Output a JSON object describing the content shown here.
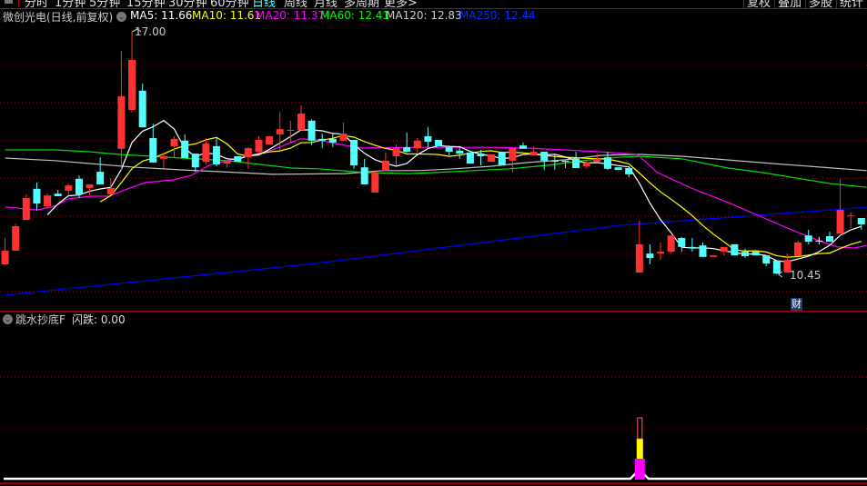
{
  "menu": {
    "items": [
      "分时",
      "1分钟",
      "5分钟",
      "15分钟",
      "30分钟",
      "60分钟",
      "日线",
      "周线",
      "月线",
      "多周期",
      "更多>"
    ],
    "active_index": 6,
    "right_buttons": [
      "复权",
      "叠加",
      "多股",
      "统计"
    ]
  },
  "header": {
    "title": "微创光电(日线,前复权)",
    "ma5": "MA5: 11.66",
    "ma10": "MA10: 11.61",
    "ma20": "MA20: 11.37",
    "ma60": "MA60: 12.41",
    "ma120": "MA120: 12.83",
    "ma250": "MA250: 12.44"
  },
  "annotations": {
    "high_label": "17.00",
    "low_label": "10.45",
    "finance_badge": "财"
  },
  "indicator": {
    "title": "跳水抄底F",
    "value_label": "闪跌: 0.00",
    "signal_index": 60
  },
  "colors": {
    "up": "#ff3232",
    "down": "#54ffff",
    "ma5": "#ffffff",
    "ma10": "#ffff00",
    "ma20": "#ff00ff",
    "ma60": "#00e000",
    "ma120": "#c0c0c0",
    "ma250": "#0000ff",
    "grid": "#a00000"
  },
  "chart_data": {
    "type": "candlestick",
    "price_range": [
      10.45,
      17.0
    ],
    "ohlc": [
      [
        10.72,
        11.43,
        10.72,
        11.09
      ],
      [
        11.09,
        11.82,
        11.09,
        11.75
      ],
      [
        11.92,
        12.61,
        11.92,
        12.51
      ],
      [
        12.76,
        12.93,
        12.17,
        12.36
      ],
      [
        12.29,
        12.63,
        12.24,
        12.58
      ],
      [
        12.63,
        12.73,
        12.56,
        12.56
      ],
      [
        12.71,
        12.9,
        12.58,
        12.85
      ],
      [
        13.03,
        13.12,
        12.51,
        12.61
      ],
      [
        12.78,
        12.88,
        12.58,
        12.88
      ],
      [
        13.22,
        13.61,
        12.88,
        12.88
      ],
      [
        12.61,
        13.05,
        12.61,
        12.78
      ],
      [
        13.84,
        16.48,
        13.27,
        15.26
      ],
      [
        14.89,
        17.0,
        14.82,
        16.24
      ],
      [
        15.41,
        15.6,
        14.42,
        14.42
      ],
      [
        14.13,
        14.52,
        13.47,
        13.47
      ],
      [
        13.57,
        13.74,
        13.32,
        13.64
      ],
      [
        13.91,
        14.18,
        13.61,
        14.11
      ],
      [
        14.06,
        14.23,
        13.59,
        13.59
      ],
      [
        13.71,
        13.71,
        13.22,
        13.34
      ],
      [
        13.49,
        14.13,
        13.42,
        13.98
      ],
      [
        13.91,
        14.13,
        13.37,
        13.42
      ],
      [
        13.44,
        13.52,
        13.32,
        13.52
      ],
      [
        13.64,
        13.64,
        13.49,
        13.49
      ],
      [
        13.61,
        13.88,
        13.3,
        13.86
      ],
      [
        13.76,
        14.18,
        13.76,
        14.08
      ],
      [
        13.96,
        14.18,
        13.96,
        14.18
      ],
      [
        14.23,
        14.84,
        13.81,
        14.37
      ],
      [
        14.33,
        14.6,
        14.01,
        14.35
      ],
      [
        14.35,
        15.01,
        14.35,
        14.79
      ],
      [
        14.6,
        14.64,
        13.93,
        14.06
      ],
      [
        14.11,
        14.25,
        13.86,
        14.06
      ],
      [
        14.11,
        14.25,
        13.88,
        14.01
      ],
      [
        14.06,
        14.55,
        14.06,
        14.25
      ],
      [
        14.08,
        14.08,
        13.3,
        13.39
      ],
      [
        13.34,
        13.57,
        12.88,
        12.88
      ],
      [
        12.66,
        13.22,
        12.66,
        13.2
      ],
      [
        13.25,
        13.74,
        13.25,
        13.52
      ],
      [
        13.64,
        13.96,
        13.39,
        13.86
      ],
      [
        13.88,
        14.28,
        13.74,
        13.76
      ],
      [
        13.86,
        14.13,
        13.74,
        14.06
      ],
      [
        14.18,
        14.42,
        13.88,
        14.03
      ],
      [
        14.08,
        14.08,
        13.91,
        13.91
      ],
      [
        13.88,
        13.93,
        13.66,
        13.76
      ],
      [
        13.79,
        13.86,
        13.57,
        13.71
      ],
      [
        13.74,
        13.74,
        13.44,
        13.44
      ],
      [
        13.71,
        13.81,
        13.39,
        13.64
      ],
      [
        13.49,
        13.69,
        13.49,
        13.69
      ],
      [
        13.76,
        13.76,
        13.39,
        13.39
      ],
      [
        13.52,
        13.88,
        13.2,
        13.86
      ],
      [
        13.93,
        14.01,
        13.84,
        13.84
      ],
      [
        13.66,
        13.91,
        13.66,
        13.76
      ],
      [
        13.76,
        13.76,
        13.27,
        13.52
      ],
      [
        13.52,
        13.71,
        13.27,
        13.49
      ],
      [
        13.52,
        13.52,
        13.32,
        13.49
      ],
      [
        13.57,
        13.76,
        13.32,
        13.32
      ],
      [
        13.37,
        13.54,
        13.3,
        13.47
      ],
      [
        13.49,
        13.71,
        13.49,
        13.57
      ],
      [
        13.61,
        13.76,
        13.27,
        13.3
      ],
      [
        13.34,
        13.34,
        13.27,
        13.27
      ],
      [
        13.32,
        13.32,
        13.07,
        13.15
      ],
      [
        10.5,
        11.9,
        10.5,
        11.26
      ],
      [
        11.01,
        11.26,
        10.72,
        10.89
      ],
      [
        11.01,
        11.31,
        10.84,
        11.06
      ],
      [
        11.06,
        11.5,
        11.01,
        11.5
      ],
      [
        11.43,
        11.46,
        11.06,
        11.19
      ],
      [
        11.19,
        11.43,
        11.06,
        11.16
      ],
      [
        11.23,
        11.31,
        10.92,
        10.92
      ],
      [
        10.92,
        10.96,
        10.92,
        10.96
      ],
      [
        11.06,
        11.19,
        10.96,
        11.19
      ],
      [
        11.26,
        11.26,
        10.96,
        10.96
      ],
      [
        11.06,
        11.14,
        10.89,
        10.94
      ],
      [
        11.06,
        11.06,
        10.96,
        10.96
      ],
      [
        10.96,
        10.96,
        10.67,
        10.74
      ],
      [
        10.82,
        10.82,
        10.45,
        10.47
      ],
      [
        10.5,
        11.01,
        10.5,
        10.84
      ],
      [
        10.94,
        11.36,
        10.94,
        11.31
      ],
      [
        11.5,
        11.65,
        11.26,
        11.33
      ],
      [
        11.36,
        11.46,
        11.26,
        11.36
      ],
      [
        11.48,
        11.6,
        11.33,
        11.33
      ],
      [
        11.55,
        13.03,
        11.55,
        12.19
      ],
      [
        12.02,
        12.12,
        11.7,
        12.04
      ],
      [
        11.97,
        11.97,
        11.65,
        11.8
      ]
    ],
    "ma_keypoints": {
      "ma20": [
        [
          0,
          12.27
        ],
        [
          3,
          12.19
        ],
        [
          4.7,
          12.29
        ],
        [
          6,
          12.49
        ],
        [
          8.1,
          12.56
        ],
        [
          9.8,
          12.56
        ],
        [
          11.6,
          12.76
        ],
        [
          13.3,
          12.93
        ],
        [
          15.9,
          13.0
        ],
        [
          17.6,
          13.12
        ],
        [
          19.3,
          13.39
        ],
        [
          21,
          13.52
        ],
        [
          23.6,
          13.69
        ],
        [
          25.3,
          13.81
        ],
        [
          27.9,
          14.11
        ],
        [
          29.6,
          14.08
        ],
        [
          32.2,
          13.93
        ],
        [
          33.9,
          13.86
        ],
        [
          39.1,
          13.88
        ],
        [
          46,
          13.88
        ],
        [
          49.4,
          13.86
        ],
        [
          52.9,
          13.81
        ],
        [
          56.3,
          13.76
        ],
        [
          59.8,
          13.69
        ],
        [
          61.7,
          13.2
        ],
        [
          64.9,
          12.78
        ],
        [
          68.4,
          12.39
        ],
        [
          71.8,
          11.97
        ],
        [
          74.4,
          11.65
        ],
        [
          77,
          11.36
        ],
        [
          78.7,
          11.19
        ],
        [
          80.4,
          11.16
        ],
        [
          81.5,
          11.23
        ]
      ],
      "ma60": [
        [
          0,
          13.81
        ],
        [
          4.7,
          13.81
        ],
        [
          8.1,
          13.76
        ],
        [
          10.7,
          13.69
        ],
        [
          16.7,
          13.59
        ],
        [
          21,
          13.52
        ],
        [
          27.1,
          13.32
        ],
        [
          29.6,
          13.3
        ],
        [
          34,
          13.2
        ],
        [
          38.2,
          13.17
        ],
        [
          40.8,
          13.2
        ],
        [
          44.3,
          13.25
        ],
        [
          47.7,
          13.3
        ],
        [
          51.2,
          13.39
        ],
        [
          54.6,
          13.52
        ],
        [
          58,
          13.61
        ],
        [
          59.8,
          13.64
        ],
        [
          64,
          13.57
        ],
        [
          68.4,
          13.32
        ],
        [
          71.6,
          13.2
        ],
        [
          78.1,
          12.9
        ],
        [
          81.5,
          12.8
        ]
      ],
      "ma120": [
        [
          0,
          13.59
        ],
        [
          4.7,
          13.52
        ],
        [
          8.1,
          13.44
        ],
        [
          12.4,
          13.34
        ],
        [
          16.7,
          13.27
        ],
        [
          21.9,
          13.2
        ],
        [
          25.3,
          13.15
        ],
        [
          32.2,
          13.17
        ],
        [
          35.7,
          13.25
        ],
        [
          39.1,
          13.25
        ],
        [
          42.5,
          13.3
        ],
        [
          46,
          13.37
        ],
        [
          49.4,
          13.47
        ],
        [
          52.9,
          13.54
        ],
        [
          56.3,
          13.66
        ],
        [
          59.8,
          13.69
        ],
        [
          64,
          13.64
        ],
        [
          72.7,
          13.44
        ],
        [
          81.5,
          13.25
        ]
      ],
      "ma250": [
        [
          0,
          9.89
        ],
        [
          29.2,
          10.74
        ],
        [
          58,
          11.77
        ],
        [
          81.5,
          12.26
        ]
      ]
    }
  }
}
